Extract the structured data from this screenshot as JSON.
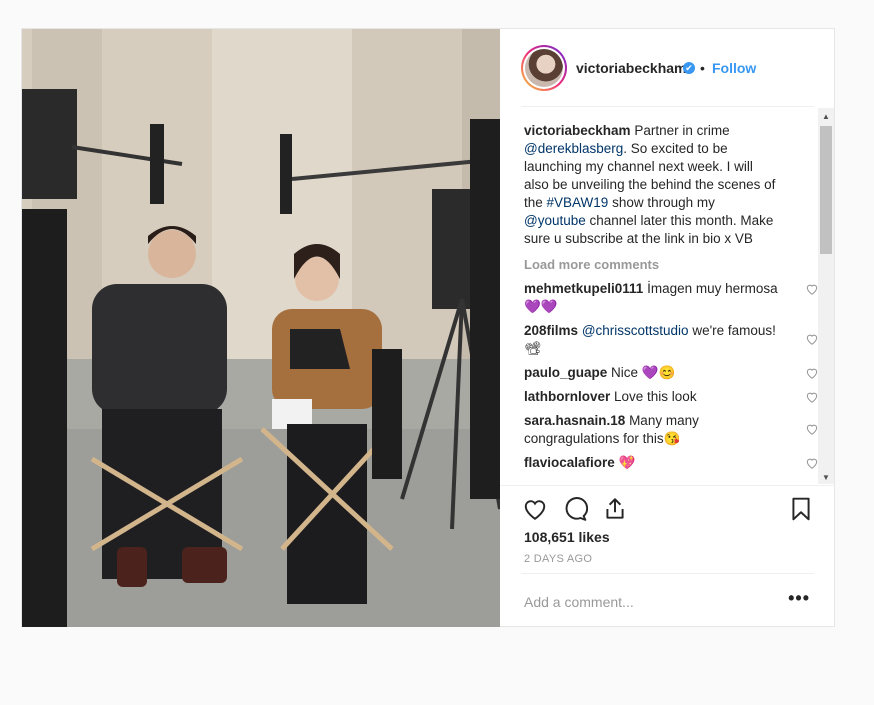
{
  "header": {
    "username": "victoriabeckham",
    "verified_mark": "✔",
    "separator": "•",
    "follow_label": "Follow"
  },
  "caption": {
    "username": "victoriabeckham",
    "text_1": " Partner in crime ",
    "mention_1": "@derekblasberg",
    "text_2": ". So excited to be launching my channel next week. I will also be unveiling the behind the scenes of the ",
    "hashtag": "#VBAW19",
    "text_3": " show through my ",
    "mention_2": "@youtube",
    "text_4": " channel later this month. Make sure u subscribe at the link in bio x VB"
  },
  "load_more": "Load more comments",
  "comments": [
    {
      "user": "mehmetkupeli0111",
      "pre": " İmagen muy hermosa",
      "mention": "",
      "post": "",
      "emoji": "💜💜"
    },
    {
      "user": "208films",
      "pre": " ",
      "mention": "@chrisscottstudio",
      "post": " we're famous!",
      "emoji": "📽"
    },
    {
      "user": "paulo_guape",
      "pre": " Nice ",
      "mention": "",
      "post": "",
      "emoji": "💜😊"
    },
    {
      "user": "lathbornlover",
      "pre": " Love this look",
      "mention": "",
      "post": "",
      "emoji": ""
    },
    {
      "user": "sara.hasnain.18",
      "pre": " Many many congragulations for this",
      "mention": "",
      "post": "",
      "emoji": "😘"
    },
    {
      "user": "flaviocalafiore",
      "pre": " ",
      "mention": "",
      "post": "",
      "emoji": "💖"
    }
  ],
  "likes": "108,651 likes",
  "time_ago": "2 DAYS AGO",
  "add_comment_placeholder": "Add a comment...",
  "more_options": "•••",
  "icons": {
    "like": "heart-icon",
    "comment": "comment-icon",
    "share": "share-icon",
    "save": "bookmark-icon"
  },
  "colors": {
    "link": "#003569",
    "follow": "#3897f0",
    "muted": "#999999"
  }
}
